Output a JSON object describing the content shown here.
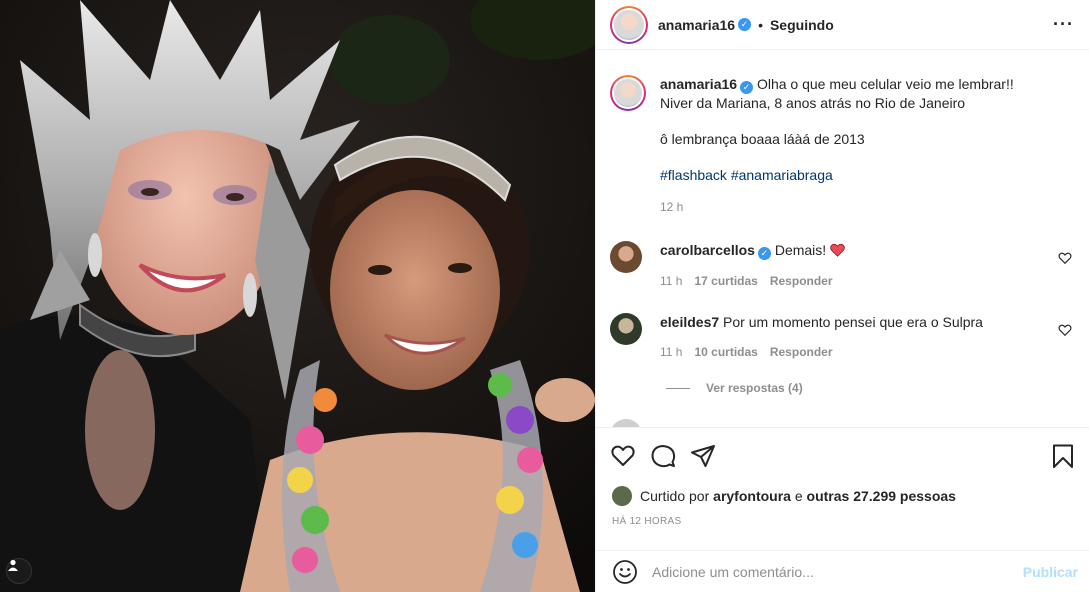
{
  "colors": {
    "verified": "#3897f0",
    "link": "#00376b",
    "muted": "#8e8e8e",
    "publish_disabled": "#b2dffc",
    "heart_red": "#ed4956"
  },
  "header": {
    "username": "anamaria16",
    "separator": "•",
    "follow_status": "Seguindo",
    "more_icon": "ellipsis-icon"
  },
  "caption": {
    "username": "anamaria16",
    "line1": "Olha o que meu celular veio me lembrar!!",
    "line2": "Niver da Mariana, 8 anos atrás no Rio de Janeiro",
    "line3": "ô lembrança boaaa láàá de 2013",
    "hashtag1": "#flashback",
    "hashtag2": "#anamariabraga",
    "time": "12 h"
  },
  "comments": [
    {
      "username": "carolbarcellos",
      "verified": true,
      "text": "Demais!",
      "emoji": "red-heart-emoji",
      "time": "11 h",
      "likes": "17 curtidas",
      "reply": "Responder"
    },
    {
      "username": "eleildes7",
      "verified": false,
      "text": "Por um momento pensei que era o Sulpra",
      "time": "11 h",
      "likes": "10 curtidas",
      "reply": "Responder",
      "view_replies": "Ver respostas (4)"
    }
  ],
  "actions": {
    "like_icon": "heart-icon",
    "comment_icon": "comment-icon",
    "share_icon": "share-icon",
    "save_icon": "bookmark-icon"
  },
  "likes": {
    "prefix": "Curtido por",
    "user": "aryfontoura",
    "middle": "e",
    "others": "outras 27.299 pessoas"
  },
  "timestamp": "HÁ 12 HORAS",
  "add_comment": {
    "placeholder": "Adicione um comentário...",
    "publish": "Publicar"
  }
}
